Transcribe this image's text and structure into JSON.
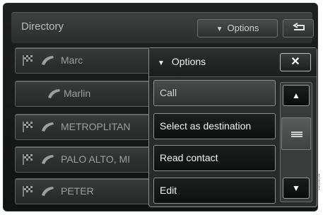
{
  "header": {
    "title": "Directory",
    "options_label": "Options",
    "back_icon": "back-return-icon"
  },
  "contacts": [
    {
      "name": "Marc",
      "has_flag": true,
      "icon": "phone-icon"
    },
    {
      "name": "Marlin",
      "has_flag": false,
      "icon": "phone-icon"
    },
    {
      "name": "METROPLITAN",
      "has_flag": true,
      "icon": "phone-icon"
    },
    {
      "name": "PALO ALTO, MI",
      "has_flag": true,
      "icon": "phone-icon"
    },
    {
      "name": "PETER",
      "has_flag": true,
      "icon": "phone-icon"
    }
  ],
  "options_menu": {
    "title": "Options",
    "close_icon": "close-x-icon",
    "items": [
      {
        "label": "Call",
        "style": "dim"
      },
      {
        "label": "Select as destination",
        "style": "normal"
      },
      {
        "label": "Read contact",
        "style": "normal"
      },
      {
        "label": "Edit",
        "style": "normal"
      }
    ],
    "scroll_up_icon": "scroll-up-icon",
    "scroll_down_icon": "scroll-down-icon"
  },
  "colors": {
    "background": "#1a1b1b",
    "text_primary": "#f3f3f3",
    "text_muted": "#9aa09c"
  }
}
